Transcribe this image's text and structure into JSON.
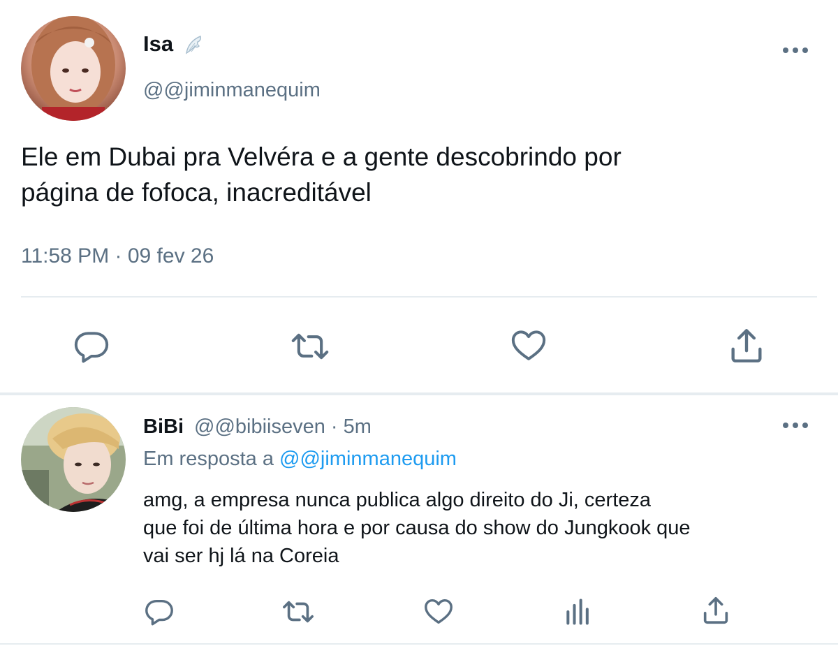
{
  "main_tweet": {
    "display_name": "Isa",
    "badge_icon": "angel-wing-icon",
    "handle": "@@jiminmanequim",
    "text_line1": "Ele em Dubai pra Velvéra e a gente descobrindo por",
    "text_line2": "página de fofoca, inacreditável",
    "timestamp": "11:58 PM · 09 fev 26",
    "actions": [
      "reply-icon",
      "retweet-icon",
      "like-icon",
      "share-icon"
    ]
  },
  "reply_tweet": {
    "display_name": "BiBi",
    "handle_time": "@@bibiiseven · 5m",
    "replying_to_label": "Em resposta a",
    "replying_to_handle": "@@jiminmanequim",
    "text_line1": "amg, a empresa nunca publica algo direito do Ji, certeza",
    "text_line2": "que foi de última hora e por causa do show do Jungkook que",
    "text_line3": "vai ser hj lá na Coreia",
    "actions": [
      "reply-icon",
      "retweet-icon",
      "like-icon",
      "analytics-icon",
      "share-icon"
    ]
  },
  "colors": {
    "text": "#0f1419",
    "muted": "#5b7083",
    "link": "#1d9bf0",
    "divider": "#e6ecf0"
  }
}
